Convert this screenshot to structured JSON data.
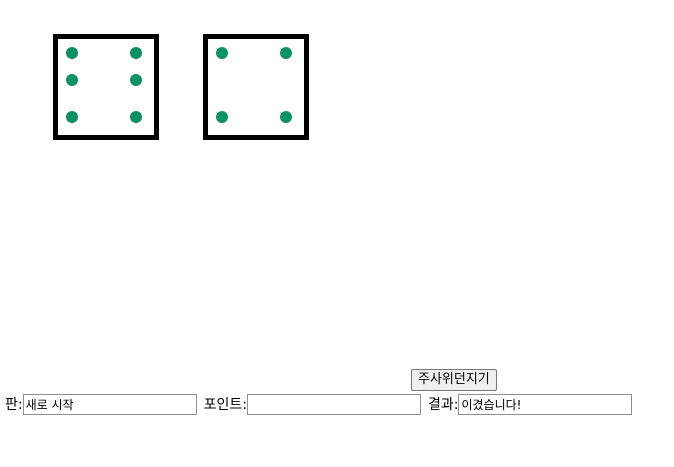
{
  "dice": [
    {
      "value": 6,
      "pip_color": "#0e9264",
      "border_color": "#000000"
    },
    {
      "value": 4,
      "pip_color": "#0e9264",
      "border_color": "#000000"
    }
  ],
  "controls": {
    "roll_button_label": "주사위던지기",
    "board_label": "판:",
    "board_value": "새로 시작",
    "point_label": "포인트:",
    "point_value": "",
    "result_label": "결과:",
    "result_value": "이겼습니다!"
  }
}
